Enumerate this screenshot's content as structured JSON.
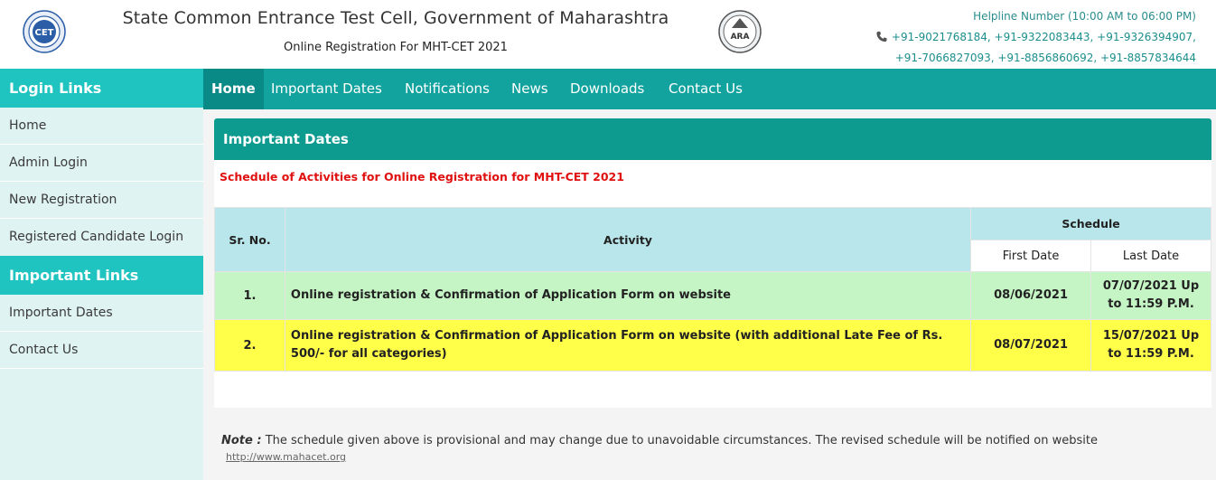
{
  "header": {
    "title": "State Common Entrance Test Cell, Government of Maharashtra",
    "subtitle": "Online Registration For MHT-CET 2021",
    "logo_left_text": "CET",
    "logo_right_text": "ARA",
    "helpline_label": "Helpline Number (10:00 AM to 06:00 PM)",
    "helpline_line1": "+91-9021768184, +91-9322083443, +91-9326394907,",
    "helpline_line2": "+91-7066827093, +91-8856860692, +91-8857834644",
    "phone_icon": "phone-icon"
  },
  "sidebar": {
    "login_heading": "Login Links",
    "login_items": [
      "Home",
      "Admin Login",
      "New Registration",
      "Registered Candidate Login"
    ],
    "important_heading": "Important Links",
    "important_items": [
      "Important Dates",
      "Contact Us"
    ]
  },
  "nav": {
    "items": [
      "Home",
      "Important Dates",
      "Notifications",
      "News",
      "Downloads",
      "Contact Us"
    ],
    "active": "Home"
  },
  "card": {
    "heading": "Important Dates",
    "schedule_title": "Schedule of Activities for Online Registration for MHT-CET 2021"
  },
  "table": {
    "col_srno": "Sr. No.",
    "col_activity": "Activity",
    "col_schedule": "Schedule",
    "col_first": "First Date",
    "col_last": "Last Date",
    "rows": [
      {
        "srno": "1.",
        "activity": "Online registration & Confirmation of Application Form on website",
        "first": "08/06/2021",
        "last": "07/07/2021 Up to 11:59 P.M."
      },
      {
        "srno": "2.",
        "activity": "Online registration & Confirmation of Application Form on website (with additional Late Fee of Rs. 500/- for all categories)",
        "first": "08/07/2021",
        "last": "15/07/2021 Up to 11:59 P.M."
      }
    ]
  },
  "note": {
    "label": "Note :",
    "text": "The schedule given above is provisional and may change due to unavoidable circumstances. The revised schedule will be notified on website",
    "link": "http://www.mahacet.org"
  },
  "colors": {
    "teal_sidebar": "#1fc4c0",
    "teal_nav": "#12a39f",
    "row1": "#c5f5c5",
    "row2": "#ffff4a",
    "schedule_red": "#e01010"
  }
}
